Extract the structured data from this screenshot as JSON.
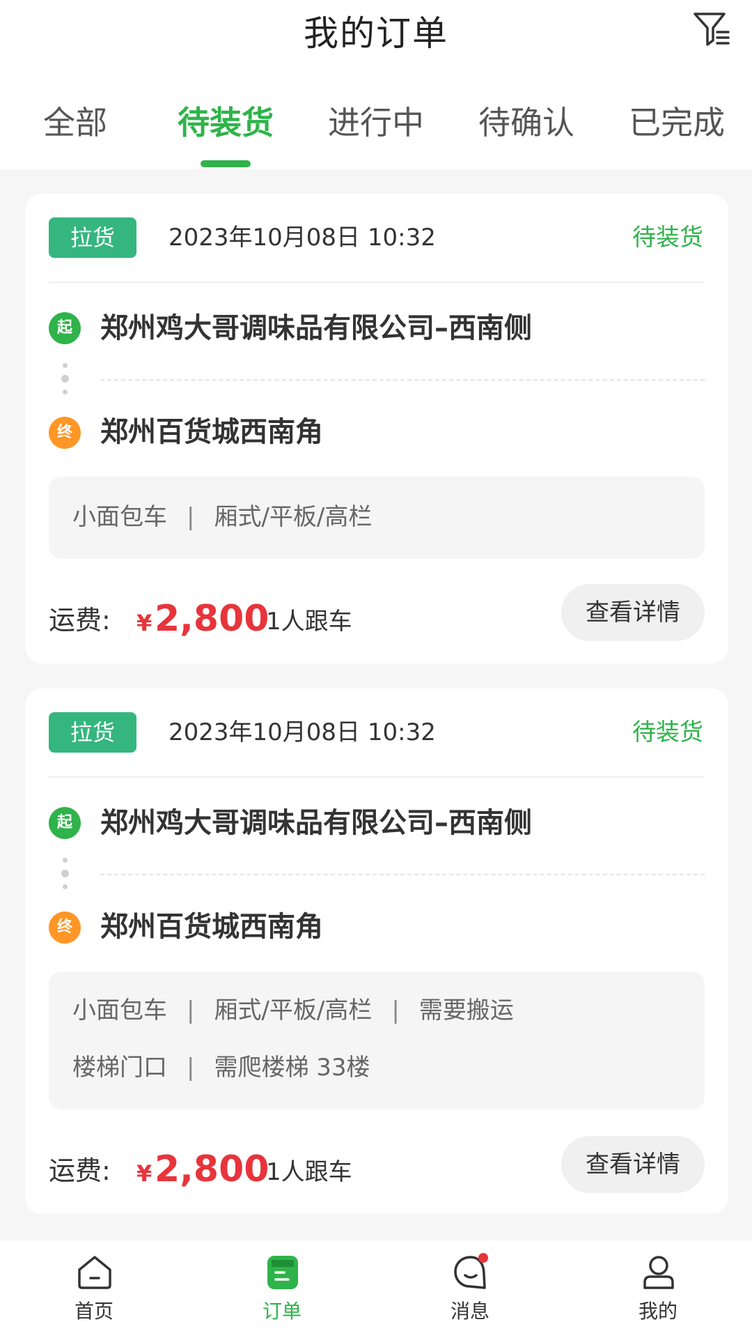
{
  "header": {
    "title": "我的订单",
    "filter_icon": "filter-icon"
  },
  "tabs": [
    {
      "label": "全部",
      "active": false
    },
    {
      "label": "待装货",
      "active": true
    },
    {
      "label": "进行中",
      "active": false
    },
    {
      "label": "待确认",
      "active": false
    },
    {
      "label": "已完成",
      "active": false
    }
  ],
  "colors": {
    "brand_green": "#2fb34a",
    "badge_green": "#34b67e",
    "start_pin": "#2fb34a",
    "end_pin": "#ff9626",
    "price_red": "#e8343b",
    "notification_dot": "#e8343b"
  },
  "orders": [
    {
      "badge": "拉货",
      "datetime": "2023年10月08日 10:32",
      "status": "待装货",
      "start_pin": "起",
      "start": "郑州鸡大哥调味品有限公司–西南侧",
      "end_pin": "终",
      "end": "郑州百货城西南角",
      "spec_lines": [
        [
          "小面包车",
          "厢式/平板/高栏"
        ]
      ],
      "fee_label": "运费:",
      "currency": "¥",
      "amount": "2,800",
      "follow": "1人跟车",
      "detail_button": "查看详情"
    },
    {
      "badge": "拉货",
      "datetime": "2023年10月08日 10:32",
      "status": "待装货",
      "start_pin": "起",
      "start": "郑州鸡大哥调味品有限公司–西南侧",
      "end_pin": "终",
      "end": "郑州百货城西南角",
      "spec_lines": [
        [
          "小面包车",
          "厢式/平板/高栏",
          "需要搬运"
        ],
        [
          "楼梯门口",
          "需爬楼梯 33楼"
        ]
      ],
      "fee_label": "运费:",
      "currency": "¥",
      "amount": "2,800",
      "follow": "1人跟车",
      "detail_button": "查看详情"
    }
  ],
  "bottom_nav": [
    {
      "label": "首页",
      "icon": "home-icon",
      "active": false
    },
    {
      "label": "订单",
      "icon": "order-icon",
      "active": true
    },
    {
      "label": "消息",
      "icon": "message-icon",
      "active": false,
      "has_badge": true
    },
    {
      "label": "我的",
      "icon": "profile-icon",
      "active": false
    }
  ]
}
